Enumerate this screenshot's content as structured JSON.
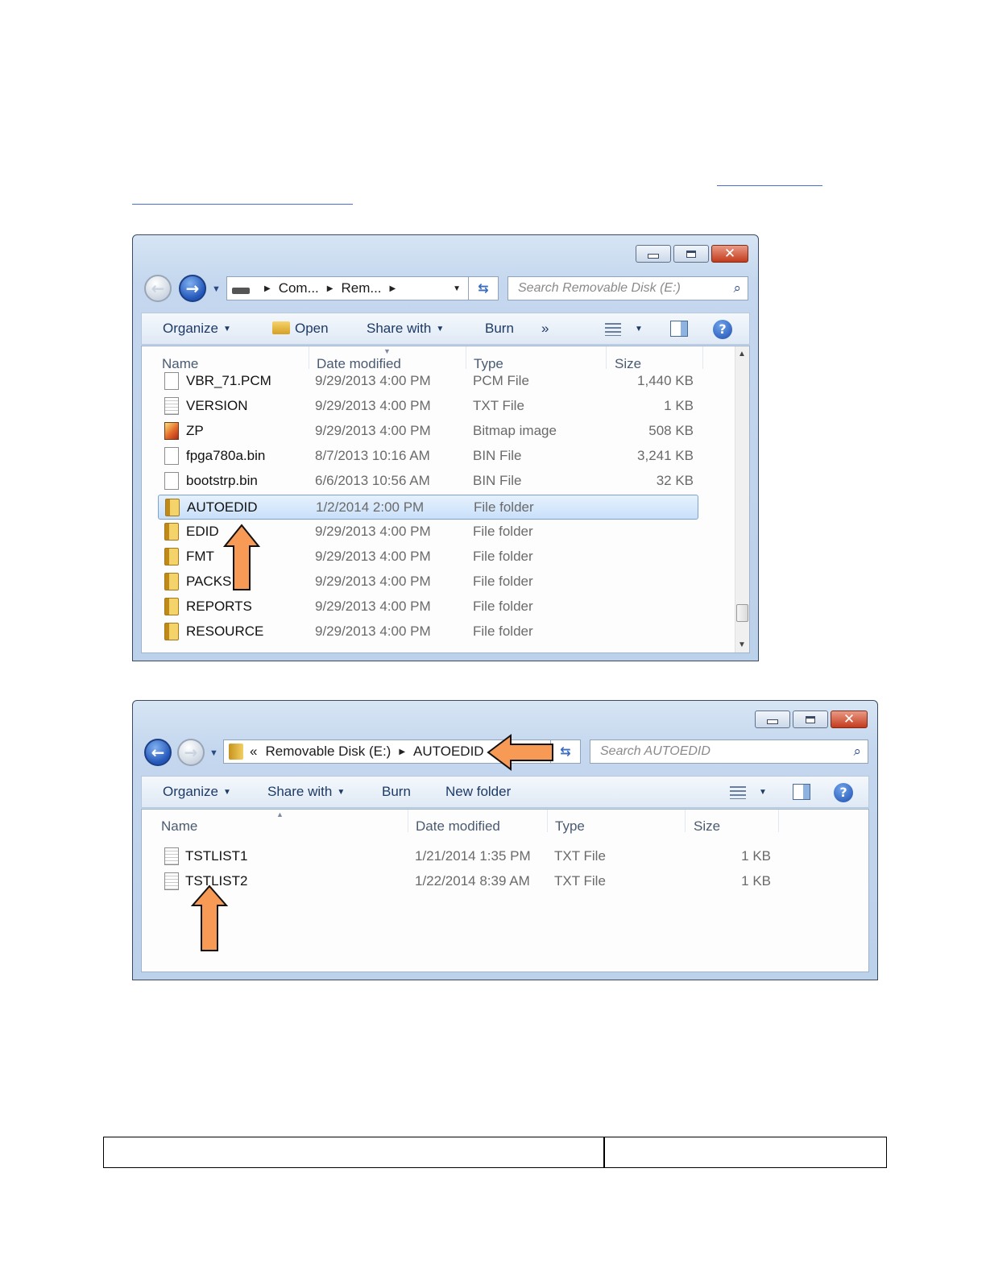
{
  "window1": {
    "address": [
      "Com...",
      "Rem..."
    ],
    "search_placeholder": "Search Removable Disk (E:)",
    "toolbar": {
      "organize": "Organize",
      "open": "Open",
      "share_with": "Share with",
      "burn": "Burn",
      "more": "»"
    },
    "columns": {
      "name": "Name",
      "date": "Date modified",
      "type": "Type",
      "size": "Size"
    },
    "rows": [
      {
        "name": "VBR_71.PCM",
        "date": "9/29/2013 4:00 PM",
        "type": "PCM File",
        "size": "1,440 KB",
        "icon": "file-icon"
      },
      {
        "name": "VERSION",
        "date": "9/29/2013 4:00 PM",
        "type": "TXT File",
        "size": "1 KB",
        "icon": "text-file-icon"
      },
      {
        "name": "ZP",
        "date": "9/29/2013 4:00 PM",
        "type": "Bitmap image",
        "size": "508 KB",
        "icon": "bitmap-icon"
      },
      {
        "name": "fpga780a.bin",
        "date": "8/7/2013 10:16 AM",
        "type": "BIN File",
        "size": "3,241 KB",
        "icon": "file-icon"
      },
      {
        "name": "bootstrp.bin",
        "date": "6/6/2013 10:56 AM",
        "type": "BIN File",
        "size": "32 KB",
        "icon": "file-icon"
      },
      {
        "name": "AUTOEDID",
        "date": "1/2/2014 2:00 PM",
        "type": "File folder",
        "size": "",
        "icon": "folder-icon",
        "selected": true
      },
      {
        "name": "EDID",
        "date": "9/29/2013 4:00 PM",
        "type": "File folder",
        "size": "",
        "icon": "folder-icon"
      },
      {
        "name": "FMT",
        "date": "9/29/2013 4:00 PM",
        "type": "File folder",
        "size": "",
        "icon": "folder-icon"
      },
      {
        "name": "PACKS",
        "date": "9/29/2013 4:00 PM",
        "type": "File folder",
        "size": "",
        "icon": "folder-icon"
      },
      {
        "name": "REPORTS",
        "date": "9/29/2013 4:00 PM",
        "type": "File folder",
        "size": "",
        "icon": "folder-icon"
      },
      {
        "name": "RESOURCE",
        "date": "9/29/2013 4:00 PM",
        "type": "File folder",
        "size": "",
        "icon": "folder-icon"
      }
    ]
  },
  "window2": {
    "address_prefix": "«",
    "address": [
      "Removable Disk (E:)",
      "AUTOEDID"
    ],
    "search_placeholder": "Search AUTOEDID",
    "toolbar": {
      "organize": "Organize",
      "share_with": "Share with",
      "burn": "Burn",
      "new_folder": "New folder"
    },
    "columns": {
      "name": "Name",
      "date": "Date modified",
      "type": "Type",
      "size": "Size"
    },
    "rows": [
      {
        "name": "TSTLIST1",
        "date": "1/21/2014 1:35 PM",
        "type": "TXT File",
        "size": "1 KB",
        "icon": "text-file-icon"
      },
      {
        "name": "TSTLIST2",
        "date": "1/22/2014 8:39 AM",
        "type": "TXT File",
        "size": "1 KB",
        "icon": "text-file-icon"
      }
    ]
  },
  "colors": {
    "arrow_fill": "#f79a55",
    "selection": "#c9e0fa",
    "accent": "#2255b8"
  }
}
